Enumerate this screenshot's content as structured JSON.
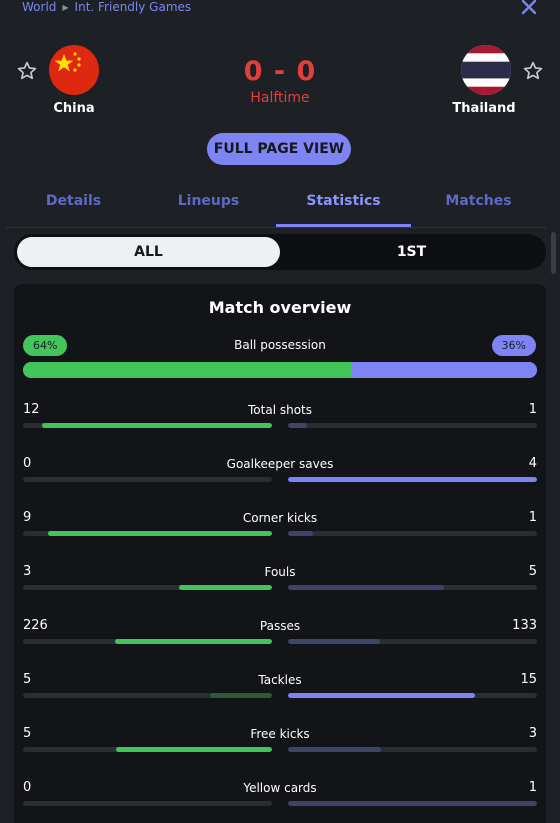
{
  "breadcrumb": {
    "root": "World",
    "competition": "Int. Friendly Games"
  },
  "match": {
    "home": {
      "name": "China"
    },
    "away": {
      "name": "Thailand"
    },
    "score": "0 - 0",
    "status": "Halftime"
  },
  "full_page_label": "FULL PAGE VIEW",
  "tabs": [
    {
      "label": "Details"
    },
    {
      "label": "Lineups"
    },
    {
      "label": "Statistics"
    },
    {
      "label": "Matches"
    }
  ],
  "active_tab": "Statistics",
  "period_toggle": {
    "options": [
      "ALL",
      "1ST"
    ],
    "selected": "ALL"
  },
  "overview": {
    "title": "Match overview",
    "possession": {
      "label": "Ball possession",
      "home": "64%",
      "away": "36%",
      "home_value": 64,
      "away_value": 36
    },
    "stats": [
      {
        "label": "Total shots",
        "home": "12",
        "away": "1",
        "home_strong": true,
        "away_strong": false
      },
      {
        "label": "Goalkeeper saves",
        "home": "0",
        "away": "4",
        "home_strong": false,
        "away_strong": true
      },
      {
        "label": "Corner kicks",
        "home": "9",
        "away": "1",
        "home_strong": true,
        "away_strong": false
      },
      {
        "label": "Fouls",
        "home": "3",
        "away": "5",
        "home_strong": true,
        "away_strong": false
      },
      {
        "label": "Passes",
        "home": "226",
        "away": "133",
        "home_strong": true,
        "away_strong": false
      },
      {
        "label": "Tackles",
        "home": "5",
        "away": "15",
        "home_strong": false,
        "away_strong": true
      },
      {
        "label": "Free kicks",
        "home": "5",
        "away": "3",
        "home_strong": true,
        "away_strong": false
      },
      {
        "label": "Yellow cards",
        "home": "0",
        "away": "1",
        "home_strong": false,
        "away_strong": false
      }
    ]
  },
  "colors": {
    "home": "#43c55c",
    "away": "#7e84f3",
    "score": "#e0403a",
    "accent": "#7e84f3"
  },
  "icons": {
    "close": "close-icon",
    "favorite": "star-outline-icon"
  }
}
